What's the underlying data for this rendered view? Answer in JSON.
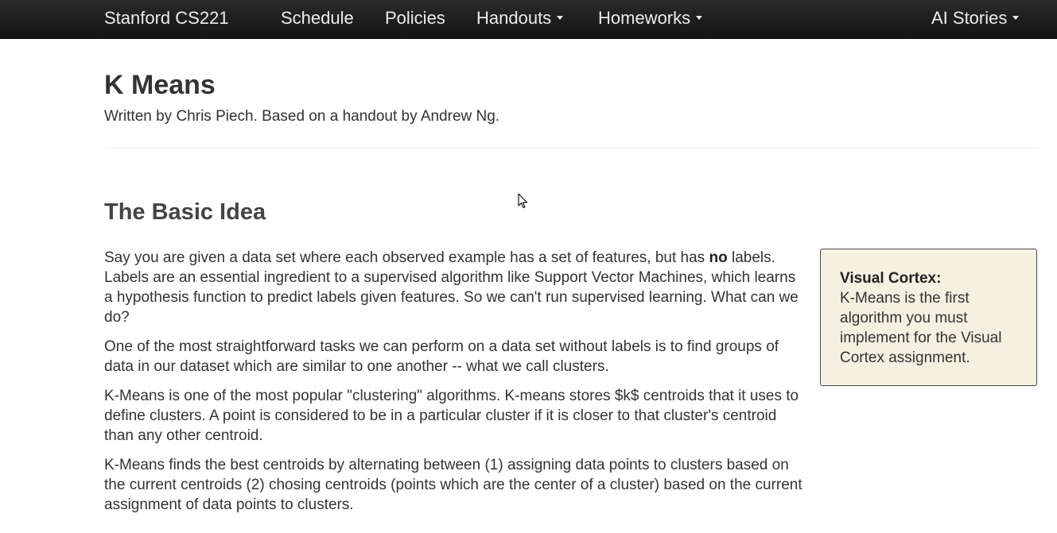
{
  "navbar": {
    "brand": "Stanford CS221",
    "items": [
      {
        "label": "Schedule"
      },
      {
        "label": "Policies"
      },
      {
        "label": "Handouts",
        "dropdown": true
      },
      {
        "label": "Homeworks",
        "dropdown": true
      }
    ],
    "right_item": {
      "label": "AI Stories",
      "dropdown": true
    }
  },
  "page": {
    "title": "K Means",
    "subtitle": "Written by Chris Piech. Based on a handout by Andrew Ng."
  },
  "section": {
    "heading": "The Basic Idea",
    "paragraphs": [
      {
        "before_bold": "Say you are given a data set where each observed example has a set of features, but has ",
        "bold": "no",
        "after_bold": " labels. Labels are an essential ingredient to a supervised algorithm like Support Vector Machines, which learns a hypothesis function to predict labels given features. So we can't run supervised learning. What can we do?"
      },
      {
        "text": "One of the most straightforward tasks we can perform on a data set without labels is to find groups of data in our dataset which are similar to one another -- what we call clusters."
      },
      {
        "text": "K-Means is one of the most popular \"clustering\" algorithms. K-means stores $k$ centroids that it uses to define clusters. A point is considered to be in a particular cluster if it is closer to that cluster's centroid than any other centroid."
      },
      {
        "text": "K-Means finds the best centroids by alternating between (1) assigning data points to clusters based on the current centroids (2) chosing centroids (points which are the center of a cluster) based on the current assignment of data points to clusters."
      }
    ]
  },
  "sidebox": {
    "title": "Visual Cortex:",
    "text": "K-Means is the first algorithm you must implement for the Visual Cortex assignment."
  },
  "colors": {
    "navbar_bg": "#1b1b1b",
    "nav_text": "#ececec",
    "sidebox_bg": "#f5f1e1"
  }
}
